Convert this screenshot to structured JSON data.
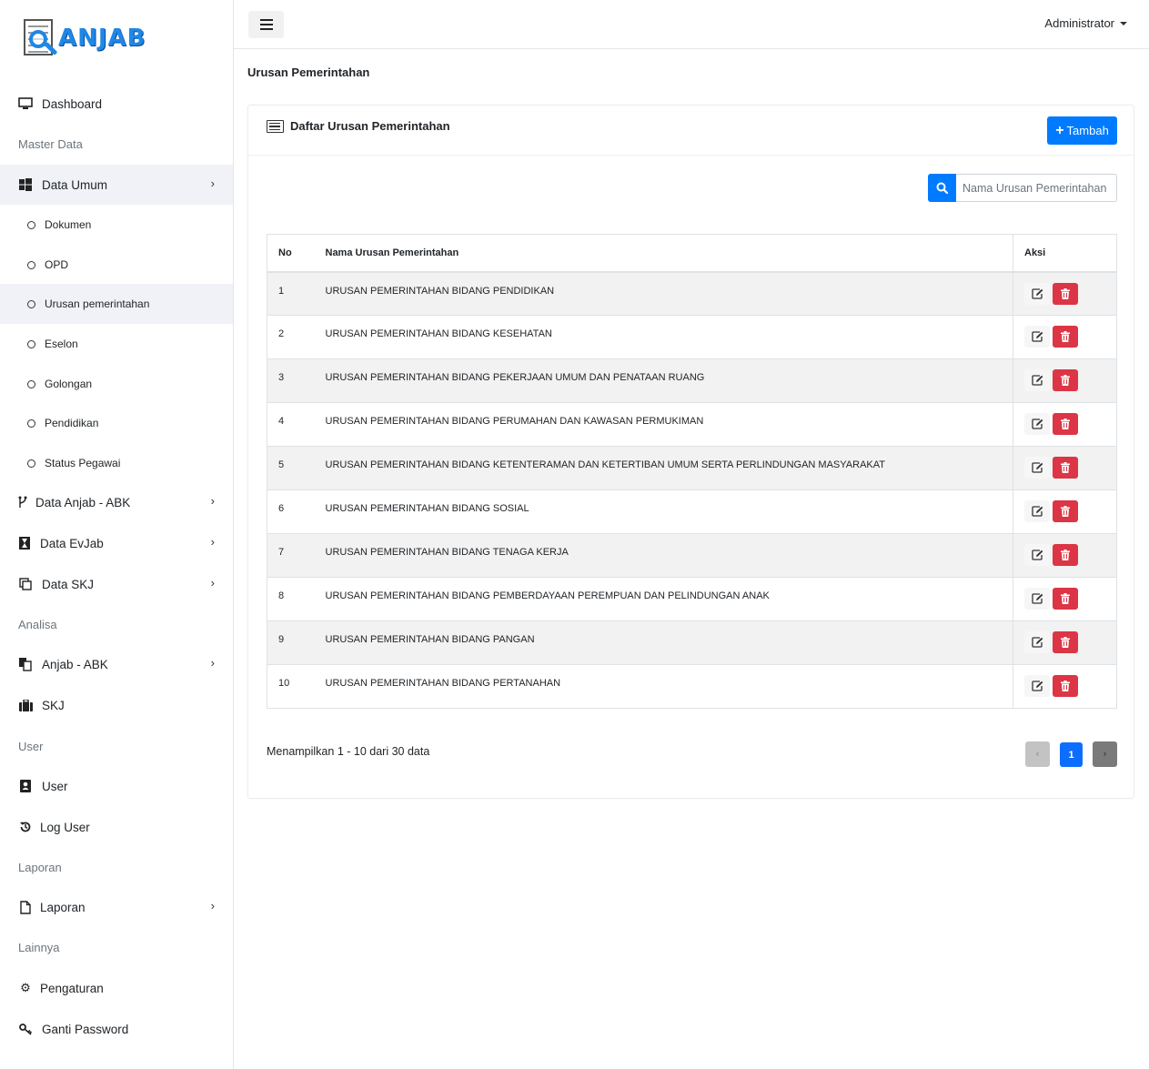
{
  "brand": {
    "name": "ANJAB"
  },
  "topbar": {
    "user_label": "Administrator"
  },
  "sidebar": {
    "dashboard": "Dashboard",
    "section_master": "Master Data",
    "data_umum": "Data Umum",
    "sub_items": [
      "Dokumen",
      "OPD",
      "Urusan pemerintahan",
      "Eselon",
      "Golongan",
      "Pendidikan",
      "Status Pegawai"
    ],
    "data_anjab_abk": "Data Anjab - ABK",
    "data_evjab": "Data EvJab",
    "data_skj": "Data SKJ",
    "section_analisa": "Analisa",
    "anjab_abk": "Anjab - ABK",
    "skj": "SKJ",
    "section_user": "User",
    "user": "User",
    "log_user": "Log User",
    "section_laporan": "Laporan",
    "laporan": "Laporan",
    "section_lainnya": "Lainnya",
    "pengaturan": "Pengaturan",
    "ganti_password": "Ganti Password"
  },
  "page": {
    "title": "Urusan Pemerintahan"
  },
  "card": {
    "title": "Daftar Urusan Pemerintahan",
    "add_button": "Tambah",
    "search_placeholder": "Nama Urusan Pemerintahan"
  },
  "table": {
    "headers": {
      "no": "No",
      "name": "Nama Urusan Pemerintahan",
      "action": "Aksi"
    },
    "rows": [
      {
        "no": "1",
        "name": "URUSAN PEMERINTAHAN BIDANG PENDIDIKAN"
      },
      {
        "no": "2",
        "name": "URUSAN PEMERINTAHAN BIDANG KESEHATAN"
      },
      {
        "no": "3",
        "name": "URUSAN PEMERINTAHAN BIDANG PEKERJAAN UMUM DAN PENATAAN RUANG"
      },
      {
        "no": "4",
        "name": "URUSAN PEMERINTAHAN BIDANG PERUMAHAN DAN KAWASAN PERMUKIMAN"
      },
      {
        "no": "5",
        "name": "URUSAN PEMERINTAHAN BIDANG KETENTERAMAN DAN KETERTIBAN UMUM SERTA PERLINDUNGAN MASYARAKAT"
      },
      {
        "no": "6",
        "name": "URUSAN PEMERINTAHAN BIDANG SOSIAL"
      },
      {
        "no": "7",
        "name": "URUSAN PEMERINTAHAN BIDANG TENAGA KERJA"
      },
      {
        "no": "8",
        "name": "URUSAN PEMERINTAHAN BIDANG PEMBERDAYAAN PEREMPUAN DAN PELINDUNGAN ANAK"
      },
      {
        "no": "9",
        "name": "URUSAN PEMERINTAHAN BIDANG PANGAN"
      },
      {
        "no": "10",
        "name": "URUSAN PEMERINTAHAN BIDANG PERTANAHAN"
      }
    ]
  },
  "pagination": {
    "summary": "Menampilkan 1 - 10 dari 30 data",
    "current_page": "1",
    "prev_symbol": "‹",
    "next_symbol": "›"
  },
  "colors": {
    "primary": "#007bff",
    "danger": "#dc3545",
    "brand": "#1e88e5",
    "row_stripe": "#f2f2f2",
    "active_nav": "#f0f2f8"
  }
}
